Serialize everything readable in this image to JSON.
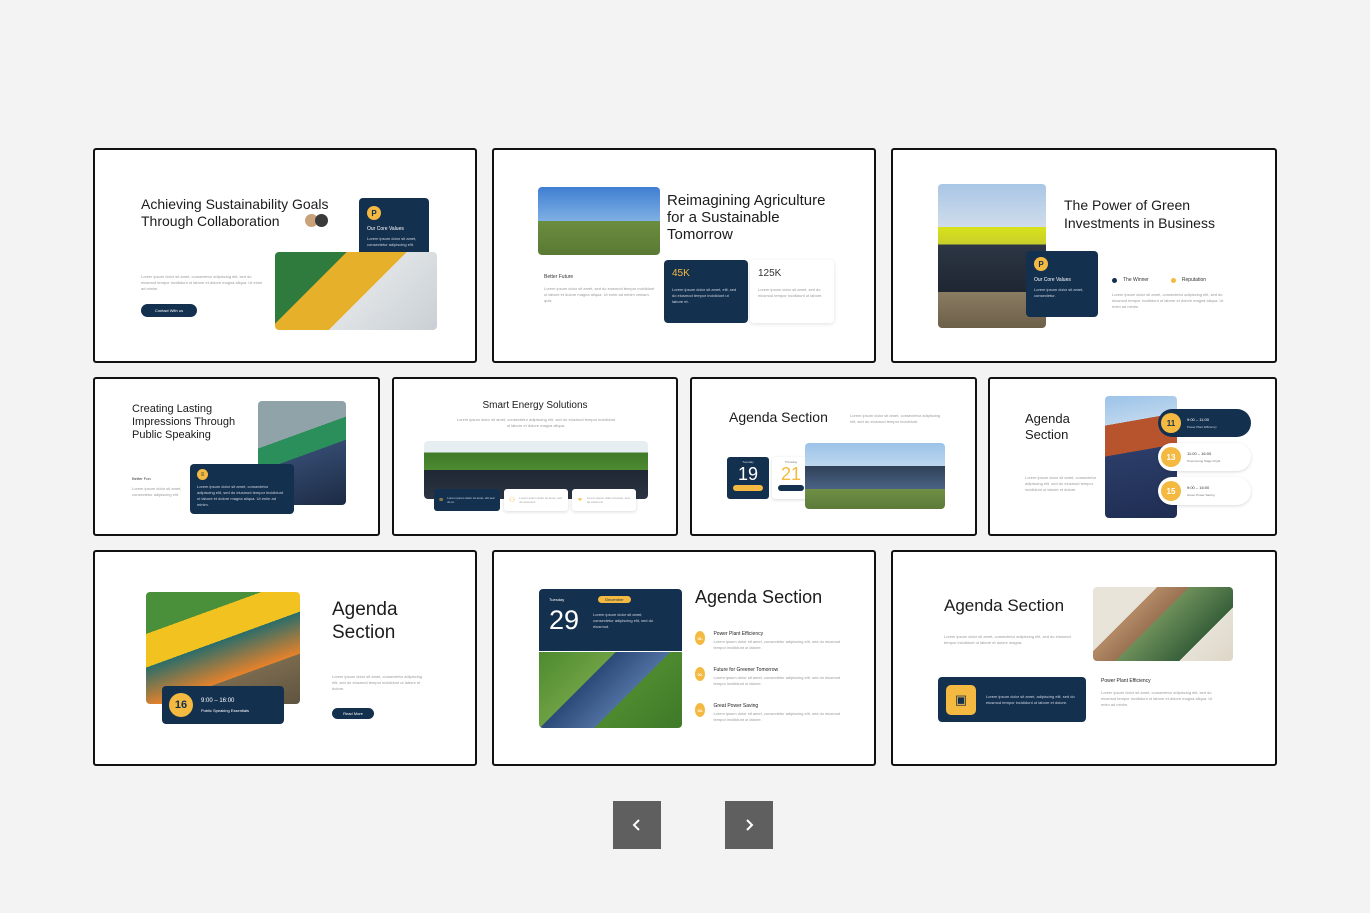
{
  "slides": {
    "s1": {
      "title": "Achieving Sustainability Goals Through Collaboration",
      "card_title": "Our Core Values",
      "card_text": "Lorem ipsum dolor sit amet, consectetur adipiscing elit.",
      "body": "Lorem ipsum dolor sit amet, consectetur adipiscing elit, sed do eiusmod tempor incididunt ut labore et dolore magna aliqua. Ut enim ad minim.",
      "button": "Contact With us"
    },
    "s2": {
      "title": "Reimagining Agriculture for a Sustainable Tomorrow",
      "sub": "Better Future",
      "body": "Lorem ipsum dolor sit amet, sed do eiusmod tempor incididunt ut labore et dolore magna aliqua. Ut enim ad minim veniam, quis.",
      "stat1": "45K",
      "stat1_text": "Lorem ipsum dolor sit amet, elit, sed do eiusmod tempor incididunt ut labore et.",
      "stat2": "125K",
      "stat2_text": "Lorem ipsum dolor sit amet, sed do eiusmod tempor incididunt ut labore."
    },
    "s3": {
      "title": "The Power of Green Investments in Business",
      "card_title": "Our Core Values",
      "card_text": "Lorem ipsum dolor sit amet, consectetur.",
      "legend1": "The Winner",
      "legend2": "Reputation",
      "body": "Lorem ipsum dolor sit amet, consectetur adipiscing elit, sed do eiusmod tempor incididunt ut labore et dolore magna aliqua. Ut enim ad minim."
    },
    "s4": {
      "title": "Creating Lasting Impressions Through Public Speaking",
      "sub": "Better Fun",
      "body": "Lorem ipsum dolor sit amet, consectetur adipiscing elit.",
      "card_text": "Lorem ipsum dolor sit amet, consectetur adipiscing elit, sed do eiusmod tempor incididunt ut labore et dolore magna aliqua. Ut enim ad minim."
    },
    "s5": {
      "title": "Smart Energy Solutions",
      "body": "Lorem ipsum dolor sit amet, consectetur adipiscing elit, sed do eiusmod tempor incididunt ut labore et dolore magna aliqua.",
      "box1": "Lorem ipsum dolor sit amet, elit sed do et.",
      "box2": "Lorem ipsum dolor sit amet, sed do eiusmod.",
      "box3": "Lorem ipsum dolor sit amet, sed do eiusmod."
    },
    "s6": {
      "title": "Agenda Section",
      "body": "Lorem ipsum dolor sit amet, consectetur adipiscing elit, sed do eiusmod tempor incididunt.",
      "day1": "19",
      "day1_label": "Tuesday",
      "day1_month": "February",
      "day2": "21",
      "day2_label": "Thursday",
      "day2_month": "February"
    },
    "s7": {
      "title": "Agenda Section",
      "body": "Lorem ipsum dolor sit amet, consectetur adipiscing elit, sed do eiusmod tempor incididunt ut labore et dolore.",
      "items": [
        {
          "num": "11",
          "time": "9:00 – 11:00",
          "label": "Power Plant Efficiency"
        },
        {
          "num": "13",
          "time": "11:00 – 16:00",
          "label": "Overcoming Stage Fright"
        },
        {
          "num": "15",
          "time": "9:00 – 16:00",
          "label": "Green Power Saving"
        }
      ]
    },
    "s8": {
      "title": "Agenda Section",
      "num": "16",
      "time": "9:00 – 16:00",
      "label": "Public Speaking Essentials",
      "body": "Lorem ipsum dolor sit amet, consectetur adipiscing elit, sed do eiusmod tempor incididunt ut labore et dolore.",
      "button": "Read More"
    },
    "s9": {
      "title": "Agenda Section",
      "day_label": "Tuesday",
      "month": "December",
      "day": "29",
      "day_text": "Lorem ipsum dolor sit amet, consectetur adipiscing elit, sed do eiusmod.",
      "items": [
        {
          "num": "01.",
          "label": "Power Plant Efficiency",
          "text": "Lorem ipsum dolor sit amet, consectetur adipiscing elit, sed do eiusmod tempor incididunt ut labore."
        },
        {
          "num": "02.",
          "label": "Future for Greener Tomorrow",
          "text": "Lorem ipsum dolor sit amet, consectetur adipiscing elit, sed do eiusmod tempor incididunt ut labore."
        },
        {
          "num": "03.",
          "label": "Great Power Saving",
          "text": "Lorem ipsum dolor sit amet, consectetur adipiscing elit, sed do eiusmod tempor incididunt ut labore."
        }
      ]
    },
    "s10": {
      "title": "Agenda Section",
      "body": "Lorem ipsum dolor sit amet, consectetur adipiscing elit, sed do eiusmod tempor incididunt ut labore et dolore magna.",
      "card_text": "Lorem ipsum dolor sit amet, adipiscing elit, sed do eiusmod tempor incididunt ut labore et dolore.",
      "sub": "Power Plant Efficiency",
      "sub_text": "Lorem ipsum dolor sit amet, consectetur adipiscing elit, sed do eiusmod tempor incididunt ut labore et dolore magna aliqua. Ut enim ad minim."
    }
  },
  "nav": {
    "prev_icon": "chevron-left-icon",
    "next_icon": "chevron-right-icon"
  },
  "colors": {
    "background": "#f3f3f4",
    "navy": "#14304f",
    "gold": "#f4b940",
    "button": "#5f5f5f"
  }
}
